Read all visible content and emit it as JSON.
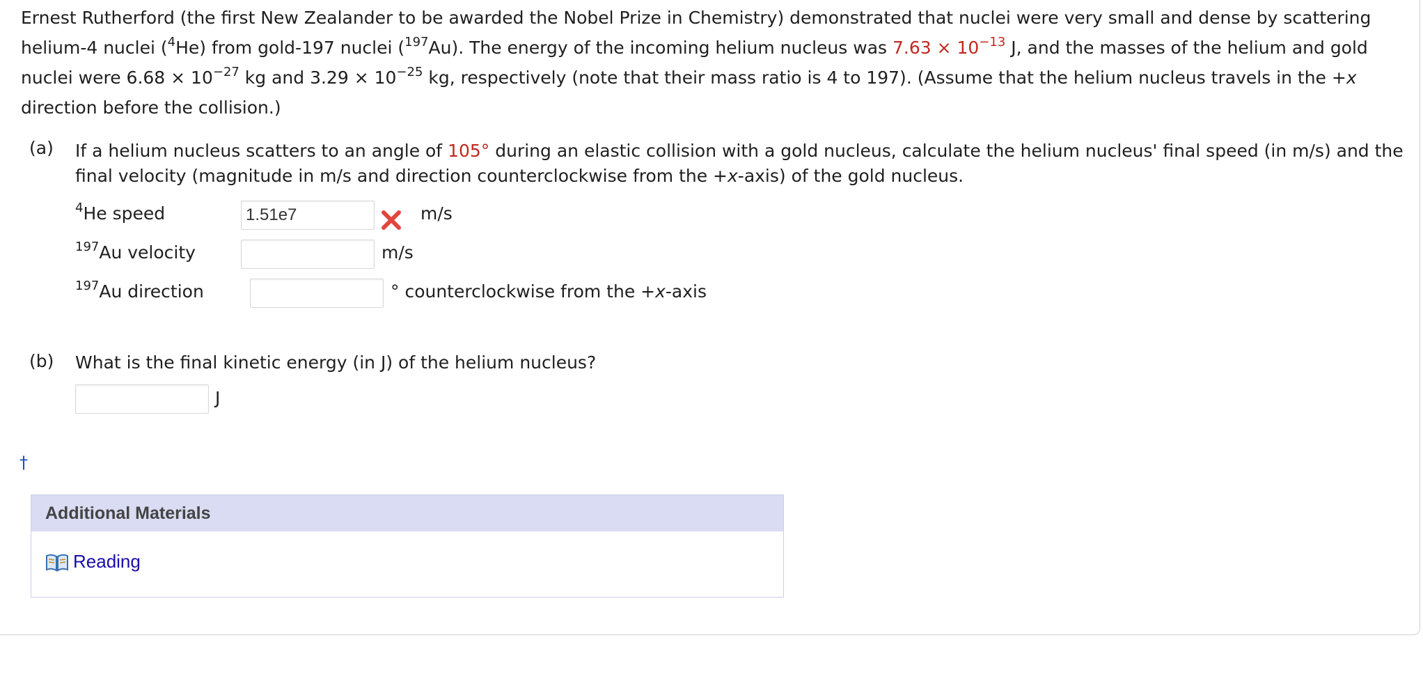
{
  "intro": {
    "p1": "Ernest Rutherford (the first New Zealander to be awarded the Nobel Prize in Chemistry) demonstrated that nuclei were very small and dense by scattering helium-4 nuclei (",
    "he_sup": "4",
    "p2": "He) from gold-197 nuclei (",
    "au_sup": "197",
    "p3": "Au). The energy of the incoming helium nucleus was ",
    "energy_base": "7.63 × 10",
    "energy_exp": "−13",
    "p4": " J, and the masses of the helium and gold nuclei were 6.68 × 10",
    "m1_exp": "−27",
    "p5": " kg and 3.29 × 10",
    "m2_exp": "−25",
    "p6": " kg, respectively (note that their mass ratio is 4 to 197). (Assume that the helium nucleus travels in the +",
    "x": "x",
    "p7": " direction before the collision.)"
  },
  "part_a": {
    "label": "(a)",
    "q1": "If a helium nucleus scatters to an angle of ",
    "angle": "105°",
    "q2": " during an elastic collision with a gold nucleus, calculate the helium nucleus' final speed (in m/s) and the final velocity (magnitude in m/s and direction counterclockwise from the +",
    "x": "x",
    "q3": "-axis) of the gold nucleus.",
    "rows": [
      {
        "sup": "4",
        "label": "He speed",
        "value": "1.51e7",
        "unit": "m/s",
        "status": "incorrect"
      },
      {
        "sup": "197",
        "label": "Au velocity",
        "value": "",
        "unit": "m/s"
      },
      {
        "sup": "197",
        "label": "Au direction",
        "value": "",
        "unit_pre": "° counterclockwise from the +",
        "unit_x": "x",
        "unit_post": "-axis"
      }
    ]
  },
  "part_b": {
    "label": "(b)",
    "question": "What is the final kinetic energy (in J) of the helium nucleus?",
    "value": "",
    "unit": "J"
  },
  "footnote_symbol": "†",
  "materials": {
    "header": "Additional Materials",
    "link_label": "Reading",
    "link_icon": "book-icon"
  },
  "colors": {
    "highlight": "#c0281f",
    "link": "#1a0dab",
    "materials_header_bg": "#d9dcf2",
    "error_x": "#e0473e"
  }
}
